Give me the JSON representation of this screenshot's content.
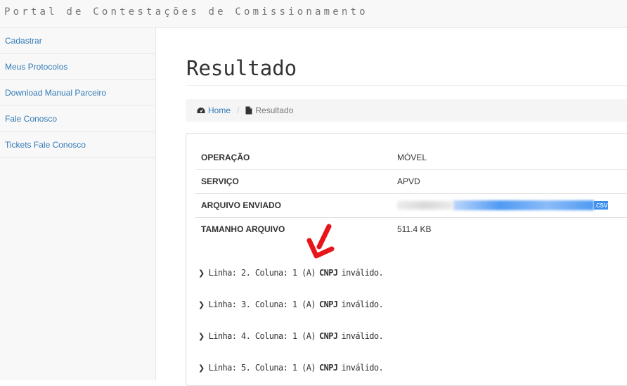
{
  "header": {
    "brand": "Portal de Contestações de Comissionamento"
  },
  "sidebar": {
    "items": [
      {
        "label": "Cadastrar"
      },
      {
        "label": "Meus Protocolos"
      },
      {
        "label": "Download Manual Parceiro"
      },
      {
        "label": "Fale Conosco"
      },
      {
        "label": "Tickets Fale Conosco"
      }
    ]
  },
  "main": {
    "title": "Resultado",
    "breadcrumb": {
      "home_icon": "dashboard-icon",
      "home": "Home",
      "separator": "/",
      "current_icon": "file-icon",
      "current": "Resultado"
    },
    "info": {
      "rows": [
        {
          "label": "OPERAÇÃO",
          "value": "MÓVEL"
        },
        {
          "label": "SERVIÇO",
          "value": "APVD"
        },
        {
          "label": "ARQUIVO ENVIADO",
          "value_suffix": ".csv"
        },
        {
          "label": "TAMANHO ARQUIVO",
          "value": "511.4 KB"
        }
      ]
    },
    "errors": [
      {
        "prefix": "Linha: 2. Coluna: 1 (A)",
        "field": "CNPJ",
        "suffix": "inválido."
      },
      {
        "prefix": "Linha: 3. Coluna: 1 (A)",
        "field": "CNPJ",
        "suffix": "inválido."
      },
      {
        "prefix": "Linha: 4. Coluna: 1 (A)",
        "field": "CNPJ",
        "suffix": "inválido."
      },
      {
        "prefix": "Linha: 5. Coluna: 1 (A)",
        "field": "CNPJ",
        "suffix": "inválido."
      }
    ]
  },
  "colors": {
    "link": "#337ab7",
    "annotation_arrow": "#e8141b",
    "highlight": "#3a8ff0"
  }
}
